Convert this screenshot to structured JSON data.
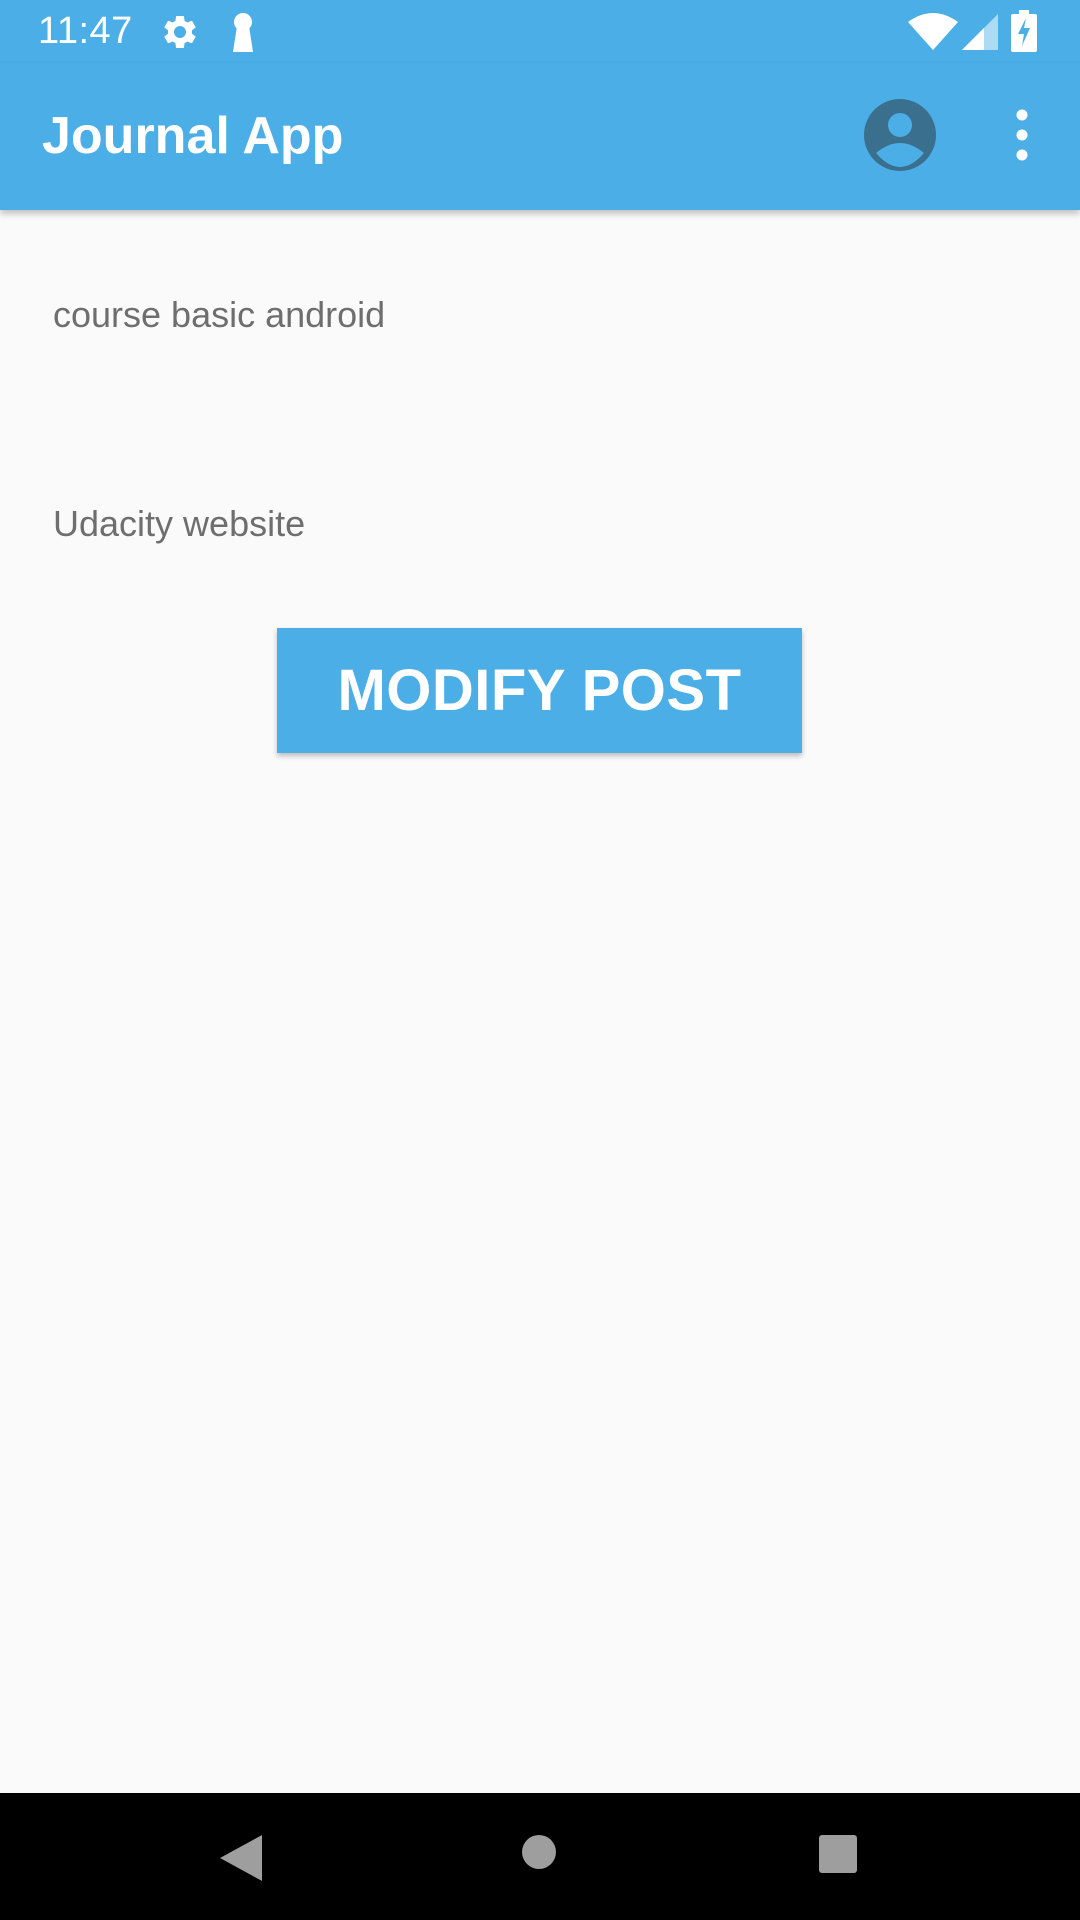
{
  "status_bar": {
    "time": "11:47",
    "icons": [
      "gear-icon",
      "keyhole-icon",
      "wifi-icon",
      "signal-icon",
      "battery-charging-icon"
    ]
  },
  "app_bar": {
    "title": "Journal App",
    "icons": [
      "account-circle-icon",
      "more-vert-icon"
    ]
  },
  "post": {
    "title": "course basic android",
    "source": "Udacity website"
  },
  "actions": {
    "modify_label": "MODIFY POST"
  },
  "nav_bar": {
    "icons": [
      "back-icon",
      "home-icon",
      "recents-icon"
    ]
  },
  "colors": {
    "primary": "#4baee6",
    "background": "#fafafa",
    "text_secondary": "#6e6e6e",
    "account_icon": "#3a6f8e"
  }
}
